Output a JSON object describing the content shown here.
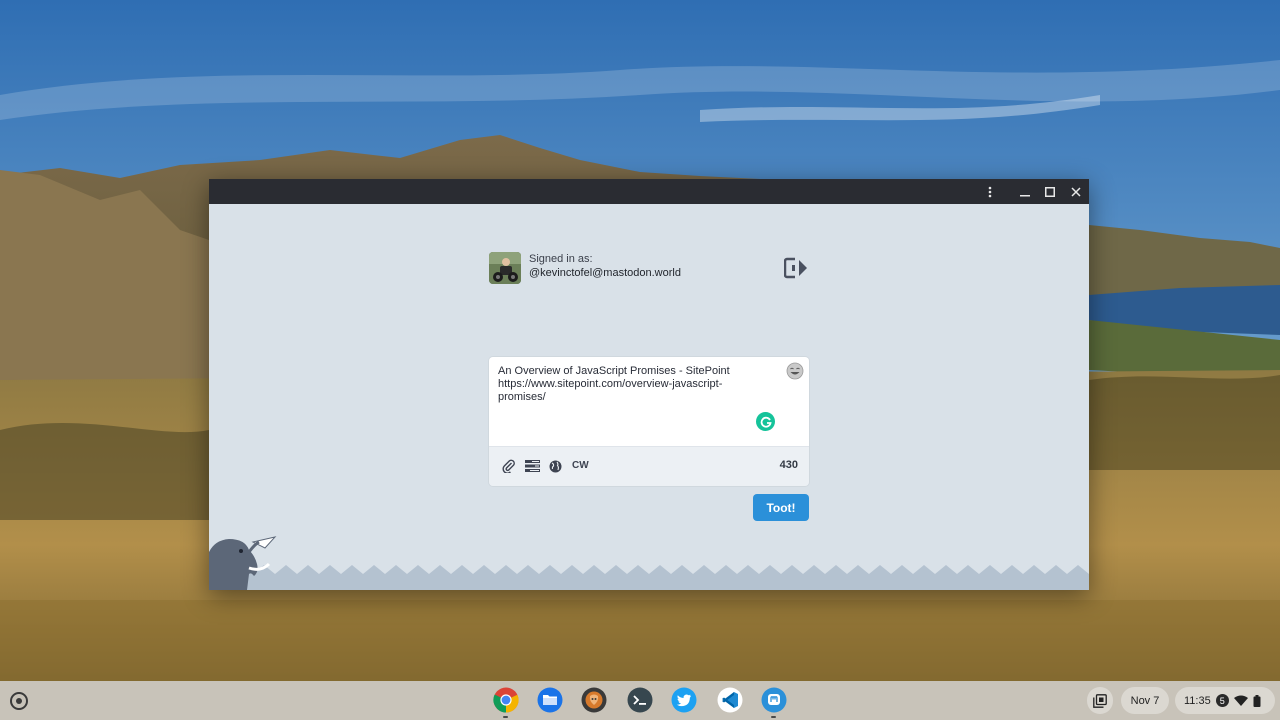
{
  "window": {
    "menu_icon": "more-vert-icon",
    "minimize_icon": "minimize-icon",
    "maximize_icon": "maximize-icon",
    "close_icon": "close-icon"
  },
  "account": {
    "signed_in_label": "Signed in as:",
    "handle": "@kevinctofel@mastodon.world",
    "logout_icon": "logout-icon"
  },
  "compose": {
    "lines": [
      "An Overview of JavaScript Promises - SitePoint",
      "https://www.sitepoint.com/overview-javascript-",
      "promises/"
    ],
    "toolbar": [
      "attach-icon",
      "poll-icon",
      "globe-icon"
    ],
    "cw_label": "CW",
    "char_count": "430",
    "submit_label": "Toot!"
  },
  "shelf": {
    "apps": [
      "Chrome",
      "Files",
      "Terminal",
      "Twitter",
      "VS Code",
      "Mastodon"
    ],
    "date": "Nov 7",
    "time": "11:35",
    "notification_count": "5"
  },
  "colors": {
    "accent": "#2b90d9",
    "window_bg": "#d9e1e8",
    "titlebar": "#2a2c32"
  }
}
